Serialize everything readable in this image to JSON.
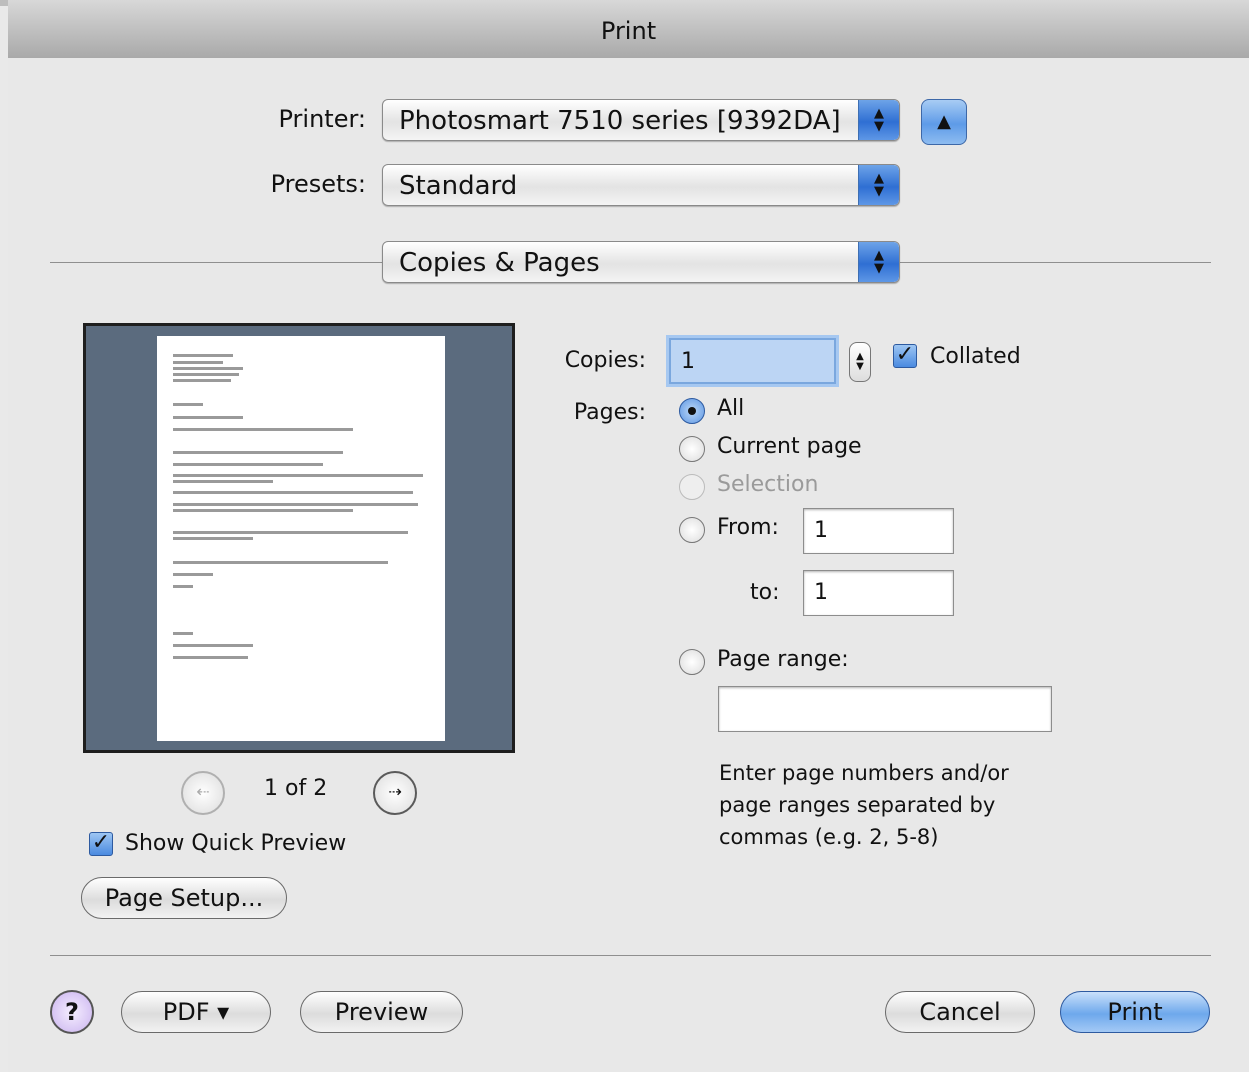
{
  "window": {
    "title": "Print"
  },
  "printer": {
    "label": "Printer:",
    "value": "Photosmart 7510 series [9392DA]"
  },
  "presets": {
    "label": "Presets:",
    "value": "Standard"
  },
  "panel": {
    "value": "Copies & Pages"
  },
  "preview": {
    "page_indicator": "1 of 2",
    "show_quick_preview_label": "Show Quick Preview",
    "show_quick_preview_checked": true
  },
  "page_setup": {
    "label": "Page Setup..."
  },
  "copies": {
    "label": "Copies:",
    "value": "1",
    "collated_label": "Collated",
    "collated_checked": true
  },
  "pages": {
    "label": "Pages:",
    "options": {
      "all": "All",
      "current": "Current page",
      "selection": "Selection",
      "from": "From:",
      "to": "to:",
      "range": "Page range:"
    },
    "selected": "All",
    "from_value": "1",
    "to_value": "1",
    "range_value": "",
    "hint": "Enter page numbers and/or page ranges separated by commas (e.g. 2, 5-8)"
  },
  "footer": {
    "help": "?",
    "pdf": "PDF ▾",
    "preview": "Preview",
    "cancel": "Cancel",
    "print": "Print"
  },
  "colors": {
    "accent": "#5e97e6",
    "preview_bg": "#5b6b7e"
  }
}
